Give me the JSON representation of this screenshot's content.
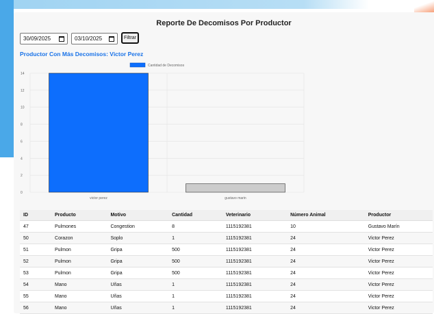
{
  "page": {
    "title": "Reporte De Decomisos Por Productor",
    "date_from": "30/09/2025",
    "date_to": "03/10/2025",
    "filter_label": "Filtrar",
    "top_producer_text": "Productor Con Más Decomisos: Victor Perez"
  },
  "chart_data": {
    "type": "bar",
    "categories": [
      "victor perez",
      "gustavo marin"
    ],
    "series": [
      {
        "name": "Cantidad de Decomisos",
        "values": [
          14,
          1
        ],
        "colors": [
          "#0d6efd",
          "#cccccc"
        ]
      }
    ],
    "yticks": [
      0,
      2,
      4,
      6,
      8,
      10,
      12,
      14
    ],
    "ylim": [
      0,
      14
    ],
    "legend": "top",
    "grid": true
  },
  "table": {
    "headers": [
      "ID",
      "Producto",
      "Motivo",
      "Cantidad",
      "Veterinario",
      "Número Animal",
      "Productor"
    ],
    "rows": [
      [
        "47",
        "Pulmones",
        "Congestion",
        "8",
        "1115192381",
        "10",
        "Gustavo Marín"
      ],
      [
        "50",
        "Corazon",
        "Soplo",
        "1",
        "1115192381",
        "24",
        "Victor Perez"
      ],
      [
        "51",
        "Pulmon",
        "Gripa",
        "500",
        "1115192381",
        "24",
        "Victor Perez"
      ],
      [
        "52",
        "Pulmon",
        "Gripa",
        "500",
        "1115192381",
        "24",
        "Victor Perez"
      ],
      [
        "53",
        "Pulmon",
        "Gripa",
        "500",
        "1115192381",
        "24",
        "Victor Perez"
      ],
      [
        "54",
        "Mano",
        "Uñas",
        "1",
        "1115192381",
        "24",
        "Victor Perez"
      ],
      [
        "55",
        "Mano",
        "Uñas",
        "1",
        "1115192381",
        "24",
        "Victor Perez"
      ],
      [
        "56",
        "Mano",
        "Uñas",
        "1",
        "1115192381",
        "24",
        "Victor Perez"
      ]
    ]
  }
}
